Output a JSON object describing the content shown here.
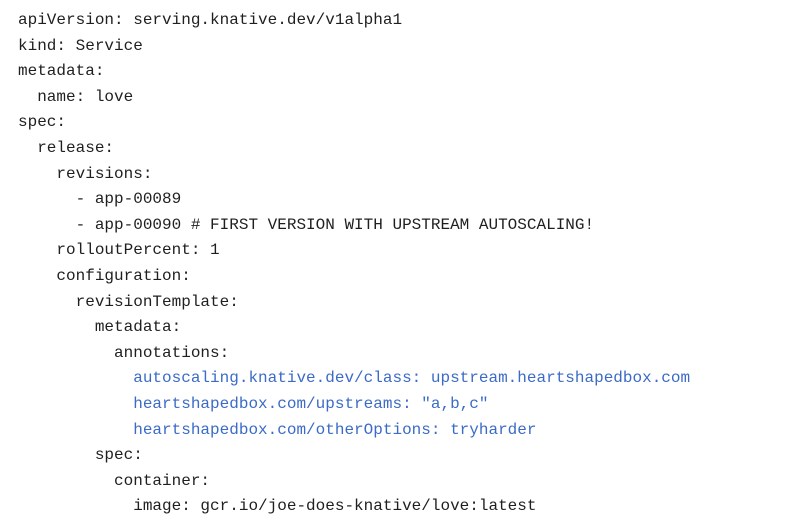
{
  "document": {
    "lines": [
      {
        "text": "apiVersion: serving.knative.dev/v1alpha1",
        "highlight": false
      },
      {
        "text": "kind: Service",
        "highlight": false
      },
      {
        "text": "metadata:",
        "highlight": false
      },
      {
        "text": "  name: love",
        "highlight": false
      },
      {
        "text": "spec:",
        "highlight": false
      },
      {
        "text": "  release:",
        "highlight": false
      },
      {
        "text": "    revisions:",
        "highlight": false
      },
      {
        "text": "      - app-00089",
        "highlight": false
      },
      {
        "text": "      - app-00090 # FIRST VERSION WITH UPSTREAM AUTOSCALING!",
        "highlight": false
      },
      {
        "text": "    rolloutPercent: 1",
        "highlight": false
      },
      {
        "text": "    configuration:",
        "highlight": false
      },
      {
        "text": "      revisionTemplate:",
        "highlight": false
      },
      {
        "text": "        metadata:",
        "highlight": false
      },
      {
        "text": "          annotations:",
        "highlight": false
      },
      {
        "text": "            autoscaling.knative.dev/class: upstream.heartshapedbox.com",
        "highlight": true
      },
      {
        "text": "            heartshapedbox.com/upstreams: \"a,b,c\"",
        "highlight": true
      },
      {
        "text": "            heartshapedbox.com/otherOptions: tryharder",
        "highlight": true
      },
      {
        "text": "        spec:",
        "highlight": false
      },
      {
        "text": "          container:",
        "highlight": false
      },
      {
        "text": "            image: gcr.io/joe-does-knative/love:latest",
        "highlight": false
      }
    ],
    "colors": {
      "text": "#1f1f1f",
      "highlight": "#3b6bc7",
      "background": "#ffffff"
    }
  }
}
